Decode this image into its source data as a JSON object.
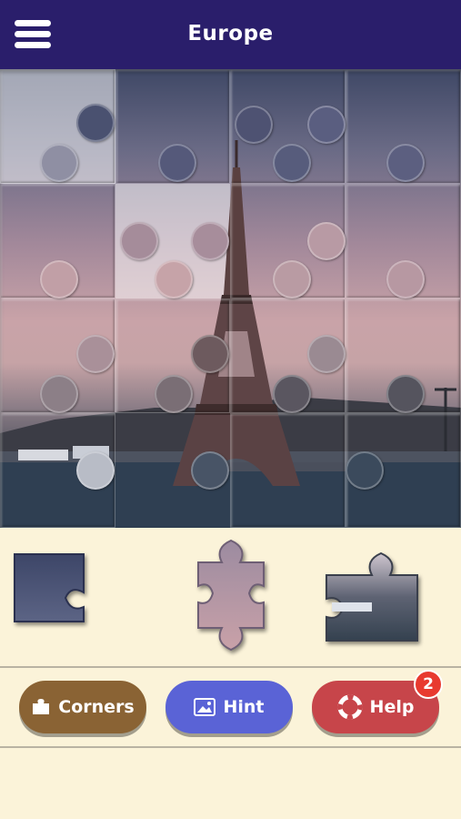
{
  "header": {
    "title": "Europe",
    "menu_icon": "hamburger-menu-icon"
  },
  "puzzle": {
    "grid_columns": 4,
    "grid_rows": 4,
    "image_subject": "Eiffel Tower at dusk",
    "tray_piece_count": 3
  },
  "buttons": {
    "corners_label": "Corners",
    "corners_icon": "corner-piece-icon",
    "hint_label": "Hint",
    "hint_icon": "image-icon",
    "help_label": "Help",
    "help_icon": "lifebuoy-icon",
    "help_badge": "2"
  },
  "colors": {
    "header_bg": "#2a1e6b",
    "tray_bg": "#fbf3d9",
    "corners_bg": "#8a6334",
    "hint_bg": "#5a63d6",
    "help_bg": "#c7454a",
    "badge_bg": "#e83a2f"
  }
}
